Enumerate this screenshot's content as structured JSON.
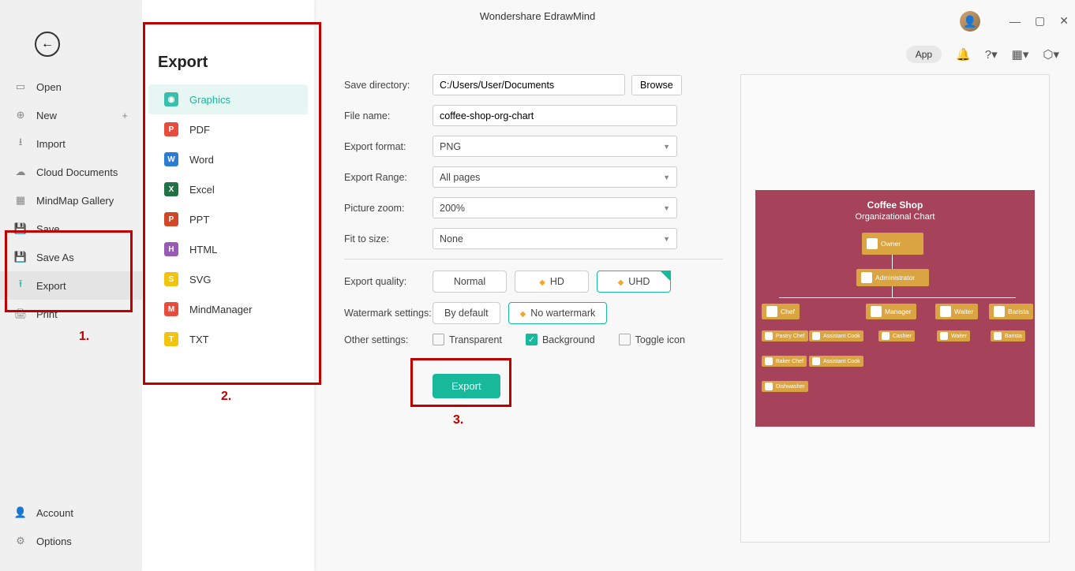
{
  "app_title": "Wondershare EdrawMind",
  "app_pill": "App",
  "left_menu": {
    "open": "Open",
    "new": "New",
    "import": "Import",
    "cloud": "Cloud Documents",
    "gallery": "MindMap Gallery",
    "save": "Save",
    "save_as": "Save As",
    "export": "Export",
    "print": "Print",
    "account": "Account",
    "options": "Options"
  },
  "export_panel": {
    "title": "Export",
    "graphics": "Graphics",
    "pdf": "PDF",
    "word": "Word",
    "excel": "Excel",
    "ppt": "PPT",
    "html": "HTML",
    "svg": "SVG",
    "mindmanager": "MindManager",
    "txt": "TXT"
  },
  "form": {
    "save_dir_label": "Save directory:",
    "save_dir_value": "C:/Users/User/Documents",
    "browse": "Browse",
    "filename_label": "File name:",
    "filename_value": "coffee-shop-org-chart",
    "format_label": "Export format:",
    "format_value": "PNG",
    "range_label": "Export Range:",
    "range_value": "All pages",
    "zoom_label": "Picture zoom:",
    "zoom_value": "200%",
    "fit_label": "Fit to size:",
    "fit_value": "None",
    "quality_label": "Export quality:",
    "quality_normal": "Normal",
    "quality_hd": "HD",
    "quality_uhd": "UHD",
    "wm_label": "Watermark settings:",
    "wm_default": "By default",
    "wm_none": "No wartermark",
    "other_label": "Other settings:",
    "chk_transparent": "Transparent",
    "chk_background": "Background",
    "chk_toggle": "Toggle icon",
    "export_btn": "Export"
  },
  "annotations": {
    "a1": "1.",
    "a2": "2.",
    "a3": "3."
  },
  "preview": {
    "title": "Coffee Shop",
    "subtitle": "Organizational Chart",
    "owner": "Owner",
    "admin": "Administrator",
    "chef": "Chef",
    "manager": "Manager",
    "waiter": "Waiter",
    "barista": "Barista",
    "pastry": "Pastry Chef",
    "asst_cook": "Assistant Cook",
    "cashier": "Cashier",
    "waiter2": "Waiter",
    "barista2": "Barista",
    "baker": "Baker Chef",
    "asst_cook2": "Assistant Cook",
    "dish": "Dishwasher"
  }
}
